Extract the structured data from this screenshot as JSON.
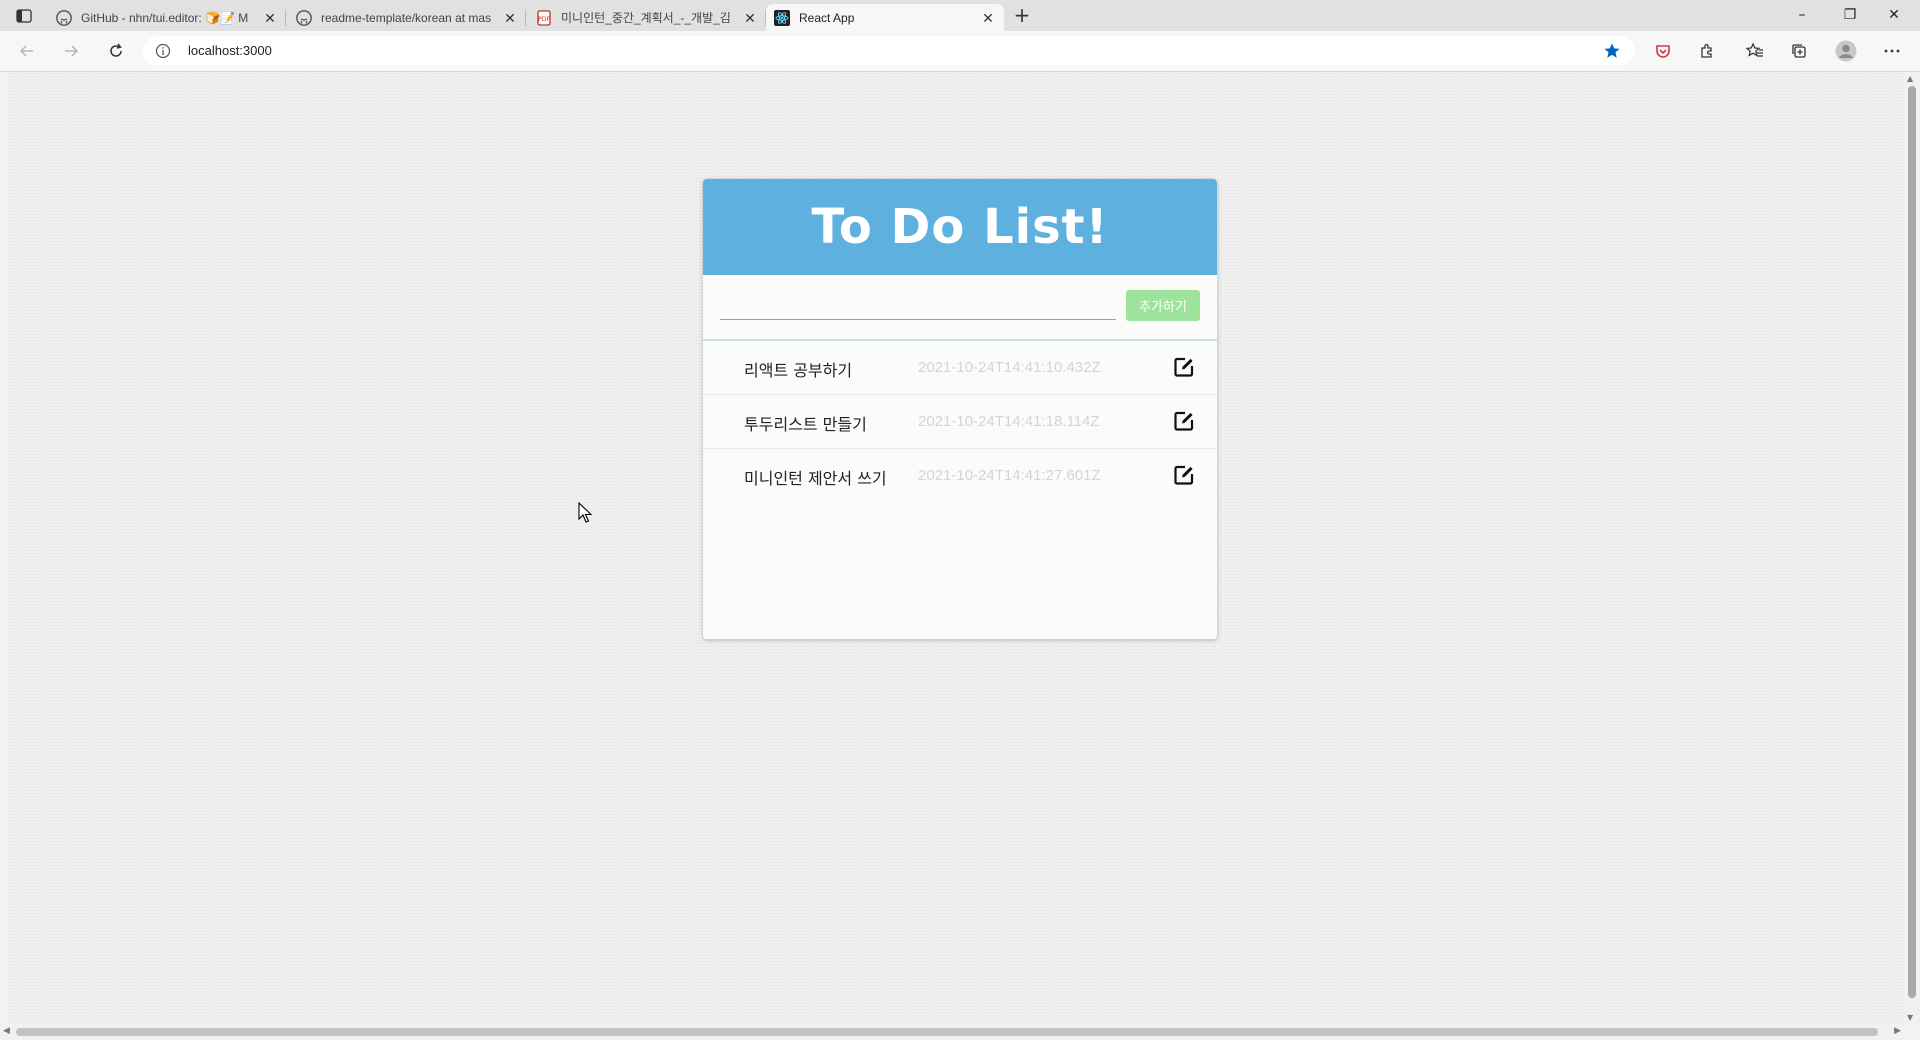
{
  "browser": {
    "tabs": [
      {
        "title": "GitHub - nhn/tui.editor: 🍞📝 M",
        "icon": "github-icon",
        "active": false
      },
      {
        "title": "readme-template/korean at mas",
        "icon": "github-icon",
        "active": false
      },
      {
        "title": "미니인턴_중간_계획서_-_개발_김",
        "icon": "pdf-icon",
        "active": false
      },
      {
        "title": "React App",
        "icon": "react-icon",
        "active": true
      }
    ],
    "address": "localhost:3000",
    "window_controls": {
      "minimize": "–",
      "restore": "❐",
      "close": "✕"
    },
    "new_tab": "+"
  },
  "app": {
    "title": "To Do List!",
    "input_value": "",
    "add_button_label": "추가하기",
    "todos": [
      {
        "text": "리액트 공부하기",
        "timestamp": "2021-10-24T14:41:10.432Z"
      },
      {
        "text": "투두리스트 만들기",
        "timestamp": "2021-10-24T14:41:18.114Z"
      },
      {
        "text": "미니인턴 제안서 쓰기",
        "timestamp": "2021-10-24T14:41:27.601Z"
      }
    ]
  },
  "colors": {
    "header": "#5eb1df",
    "add_button": "#9ee39b",
    "timestamp": "#d4d4d4"
  }
}
